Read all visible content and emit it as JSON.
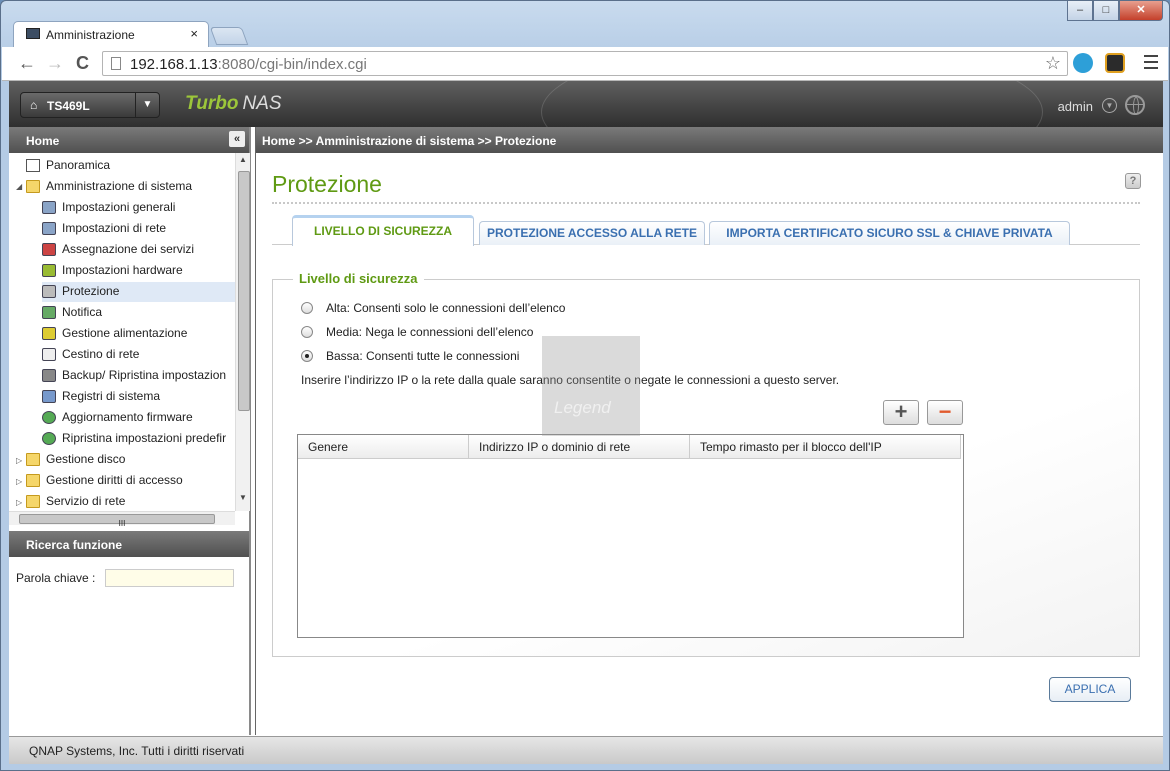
{
  "browser": {
    "tab_title": "Amministrazione",
    "tab_close": "×",
    "url_host": "192.168.1.13",
    "url_rest": ":8080/cgi-bin/index.cgi",
    "back": "←",
    "forward": "→",
    "reload": "C",
    "star": "☆"
  },
  "window": {
    "minimize": "–",
    "maximize": "□",
    "close": "✕"
  },
  "header": {
    "device_name": "TS469L",
    "brand_turbo": "Turbo",
    "brand_nas": "NAS",
    "user": "admin"
  },
  "sidebar": {
    "title": "Home",
    "collapse": "«",
    "items": [
      {
        "label": "Panoramica"
      },
      {
        "label": "Amministrazione di sistema"
      },
      {
        "label": "Impostazioni generali"
      },
      {
        "label": "Impostazioni di rete"
      },
      {
        "label": "Assegnazione dei servizi"
      },
      {
        "label": "Impostazioni hardware"
      },
      {
        "label": "Protezione"
      },
      {
        "label": "Notifica"
      },
      {
        "label": "Gestione alimentazione"
      },
      {
        "label": "Cestino di rete"
      },
      {
        "label": "Backup/ Ripristina impostazion"
      },
      {
        "label": "Registri di sistema"
      },
      {
        "label": "Aggiornamento firmware"
      },
      {
        "label": "Ripristina impostazioni predefir"
      },
      {
        "label": "Gestione disco"
      },
      {
        "label": "Gestione diritti di accesso"
      },
      {
        "label": "Servizio di rete"
      }
    ],
    "hscroll_grip": "III"
  },
  "search": {
    "title": "Ricerca funzione",
    "keyword_label": "Parola chiave :",
    "keyword_value": ""
  },
  "content": {
    "breadcrumb": "Home >> Amministrazione di sistema >> Protezione",
    "page_title": "Protezione",
    "help": "?",
    "tabs": [
      {
        "label": "LIVELLO DI SICUREZZA"
      },
      {
        "label": "PROTEZIONE ACCESSO ALLA RETE"
      },
      {
        "label": "IMPORTA CERTIFICATO SICURO SSL & CHIAVE PRIVATA"
      }
    ],
    "fieldset_legend": "Livello di sicurezza",
    "radios": [
      {
        "label": "Alta: Consenti solo le connessioni dell’elenco",
        "checked": false
      },
      {
        "label": "Media: Nega le connessioni dell’elenco",
        "checked": false
      },
      {
        "label": "Bassa: Consenti tutte le connessioni",
        "checked": true
      }
    ],
    "hint": "Inserire l’indirizzo IP o la rete dalla quale saranno consentite o negate le connessioni a questo server.",
    "add_button": "+",
    "remove_button": "−",
    "table_headers": [
      "Genere",
      "Indirizzo IP o dominio di rete",
      "Tempo rimasto per il blocco dell'IP"
    ],
    "table_rows": [],
    "apply_button": "APPLICA",
    "watermark": "Legend"
  },
  "footer": {
    "text": "QNAP Systems, Inc. Tutti i diritti riservati"
  },
  "colors": {
    "accent_green": "#5f9a13",
    "link_blue": "#3a6fb0",
    "header_dark": "#3a3a3a"
  }
}
